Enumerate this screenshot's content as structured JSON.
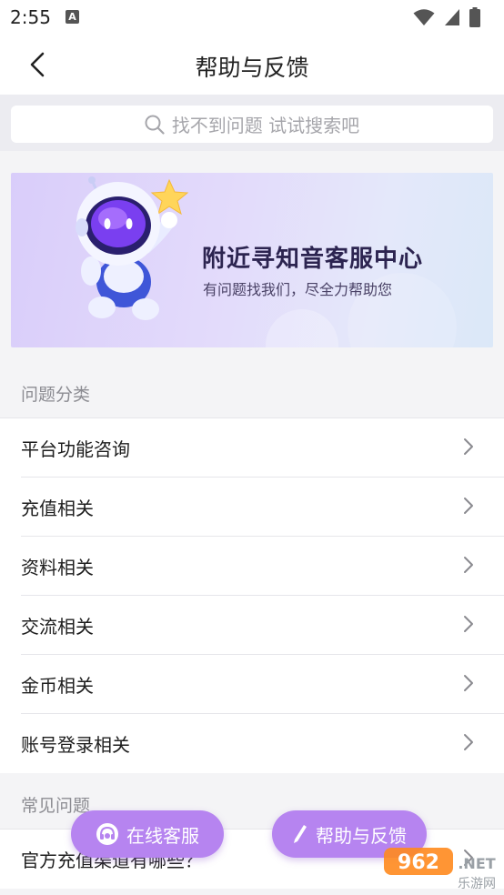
{
  "status_bar": {
    "time": "2:55",
    "notification_icon": "A"
  },
  "header": {
    "title": "帮助与反馈"
  },
  "search": {
    "placeholder": "找不到问题 试试搜索吧"
  },
  "banner": {
    "title": "附近寻知音客服中心",
    "subtitle": "有问题找我们，尽全力帮助您"
  },
  "categories": {
    "section_label": "问题分类",
    "items": [
      {
        "label": "平台功能咨询"
      },
      {
        "label": "充值相关"
      },
      {
        "label": "资料相关"
      },
      {
        "label": "交流相关"
      },
      {
        "label": "金币相关"
      },
      {
        "label": "账号登录相关"
      }
    ]
  },
  "faq": {
    "section_label": "常见问题",
    "items": [
      {
        "label": "官方充值渠道有哪些？"
      }
    ]
  },
  "actions": {
    "online_service_label": "在线客服",
    "help_feedback_label": "帮助与反馈"
  },
  "watermark": {
    "brand": "962",
    "suffix": ".NET",
    "caption": "乐游网"
  },
  "colors": {
    "accent": "#b684f0",
    "banner_start": "#d9cdfa",
    "banner_end": "#dbe8f8"
  }
}
